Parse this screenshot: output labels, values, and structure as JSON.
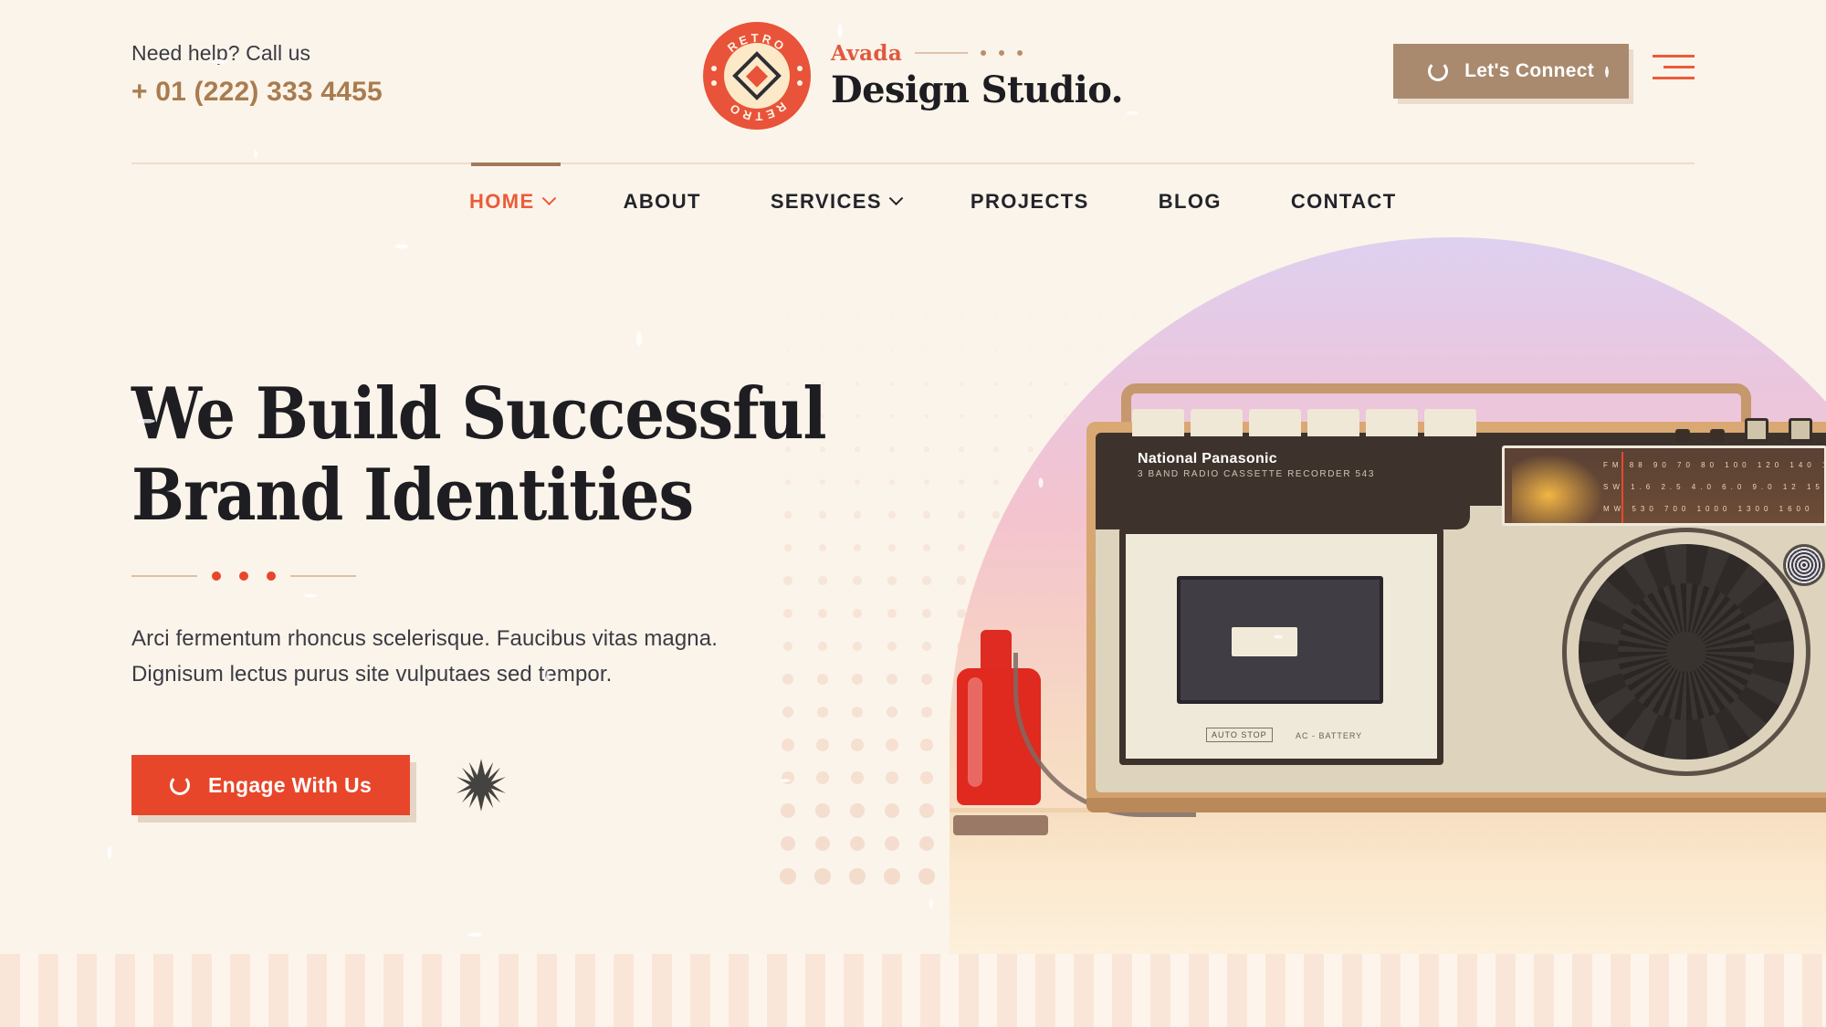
{
  "brand_colors": {
    "accent_red": "#e8462a",
    "accent_orange": "#ec5b38",
    "taupe": "#a98a6e",
    "brown": "#a97c50",
    "cream_bg": "#fbf4ea",
    "ink": "#1d1d22"
  },
  "header": {
    "call_label": "Need help? Call us",
    "call_number": "+ 01 (222) 333 4455",
    "logo": {
      "badge_text_top": "RETRO",
      "badge_text_bottom": "RETRO",
      "brand_small": "Avada",
      "brand_main": "Design Studio."
    },
    "connect_button": "Let's Connect",
    "menu_icon": "hamburger-icon"
  },
  "nav": {
    "items": [
      {
        "label": "HOME",
        "active": true,
        "has_dropdown": true
      },
      {
        "label": "ABOUT",
        "active": false,
        "has_dropdown": false
      },
      {
        "label": "SERVICES",
        "active": false,
        "has_dropdown": true
      },
      {
        "label": "PROJECTS",
        "active": false,
        "has_dropdown": false
      },
      {
        "label": "BLOG",
        "active": false,
        "has_dropdown": false
      },
      {
        "label": "CONTACT",
        "active": false,
        "has_dropdown": false
      }
    ]
  },
  "hero": {
    "title_line1": "We Build Successful",
    "title_line2": "Brand Identities",
    "paragraph_line1": "Arci fermentum rhoncus scelerisque. Faucibus vitas magna.",
    "paragraph_line2": "Dignisum lectus purus site vulputaes sed tempor.",
    "cta_button": "Engage With Us",
    "decor_icon": "starburst-icon",
    "image": {
      "subject": "vintage-radio-cassette-recorder",
      "device_brand": "National Panasonic",
      "device_model": "3 BAND RADIO CASSETTE RECORDER 543",
      "deck_label_1": "AUTO STOP",
      "deck_label_2": "AC - BATTERY"
    }
  }
}
